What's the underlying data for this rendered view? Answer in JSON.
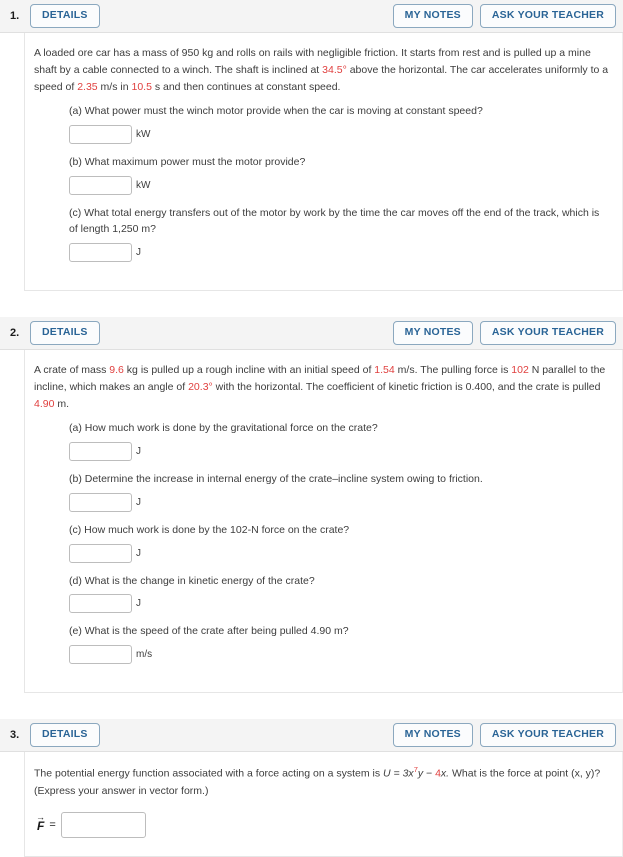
{
  "buttons": {
    "details": "DETAILS",
    "my_notes": "MY NOTES",
    "ask_teacher": "ASK YOUR TEACHER"
  },
  "problems": [
    {
      "number": "1.",
      "stem_parts": [
        {
          "t": "A loaded ore car has a mass of 950 kg and rolls on rails with negligible friction. It starts from rest and is pulled up a mine shaft by a cable connected to a winch. The shaft is inclined at ",
          "red": false
        },
        {
          "t": "34.5°",
          "red": true
        },
        {
          "t": " above the horizontal. The car accelerates uniformly to a speed of ",
          "red": false
        },
        {
          "t": "2.35",
          "red": true
        },
        {
          "t": " m/s in ",
          "red": false
        },
        {
          "t": "10.5",
          "red": true
        },
        {
          "t": " s and then continues at constant speed.",
          "red": false
        }
      ],
      "parts": [
        {
          "question": "(a) What power must the winch motor provide when the car is moving at constant speed?",
          "value": "",
          "unit": "kW"
        },
        {
          "question": "(b) What maximum power must the motor provide?",
          "value": "",
          "unit": "kW"
        },
        {
          "question": "(c) What total energy transfers out of the motor by work by the time the car moves off the end of the track, which is of length 1,250 m?",
          "value": "",
          "unit": "J"
        }
      ]
    },
    {
      "number": "2.",
      "stem_parts": [
        {
          "t": "A crate of mass ",
          "red": false
        },
        {
          "t": "9.6",
          "red": true
        },
        {
          "t": " kg is pulled up a rough incline with an initial speed of ",
          "red": false
        },
        {
          "t": "1.54",
          "red": true
        },
        {
          "t": " m/s. The pulling force is ",
          "red": false
        },
        {
          "t": "102",
          "red": true
        },
        {
          "t": " N parallel to the incline, which makes an angle of ",
          "red": false
        },
        {
          "t": "20.3°",
          "red": true
        },
        {
          "t": " with the horizontal. The coefficient of kinetic friction is 0.400, and the crate is pulled ",
          "red": false
        },
        {
          "t": "4.90",
          "red": true
        },
        {
          "t": " m.",
          "red": false
        }
      ],
      "parts": [
        {
          "question": "(a) How much work is done by the gravitational force on the crate?",
          "value": "",
          "unit": "J"
        },
        {
          "question": "(b) Determine the increase in internal energy of the crate–incline system owing to friction.",
          "value": "",
          "unit": "J"
        },
        {
          "question": "(c) How much work is done by the 102-N force on the crate?",
          "value": "",
          "unit": "J"
        },
        {
          "question": "(d) What is the change in kinetic energy of the crate?",
          "value": "",
          "unit": "J"
        },
        {
          "question": "(e) What is the speed of the crate after being pulled 4.90 m?",
          "value": "",
          "unit": "m/s"
        }
      ]
    },
    {
      "number": "3.",
      "stem_text_before": "The potential energy function associated with a force acting on a system is ",
      "formula": {
        "lhs": "U",
        "eq": " = 3x",
        "exponent": "7",
        "mid": "y − ",
        "coefficient": "4",
        "tail": "x."
      },
      "stem_text_after": " What is the force at point (x, y)? (Express your answer in vector form.)",
      "vector_answer": {
        "label": "F",
        "arrow": "→",
        "equals": "=",
        "value": ""
      }
    }
  ]
}
